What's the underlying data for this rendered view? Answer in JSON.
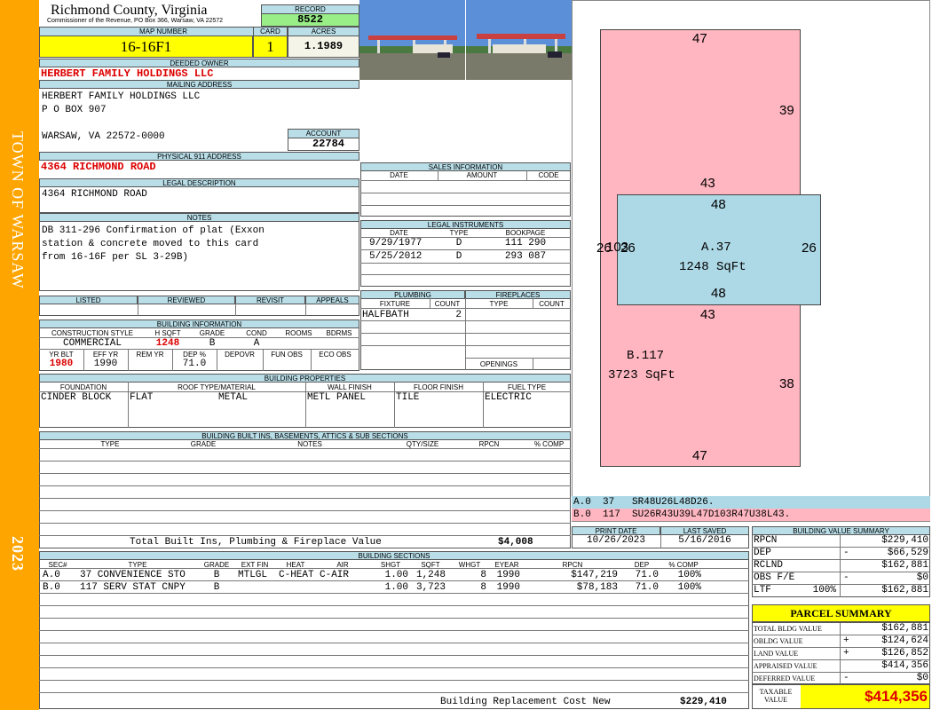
{
  "sidebar": {
    "town": "TOWN OF WARSAW",
    "year": "2023"
  },
  "header": {
    "county": "Richmond County, Virginia",
    "commissioner": "Commissioner of the Revenue, PO Box 366, Warsaw, VA 22572",
    "record_label": "RECORD",
    "record": "8522",
    "map_label": "MAP NUMBER",
    "map": "16-16F1",
    "card_label": "CARD",
    "card": "1",
    "acres_label": "ACRES",
    "acres": "1.1989"
  },
  "owner": {
    "deeded_label": "DEEDED OWNER",
    "deeded": "HERBERT FAMILY HOLDINGS LLC",
    "mailing_label": "MAILING ADDRESS",
    "mail1": "HERBERT FAMILY HOLDINGS LLC",
    "mail2": "P O BOX 907",
    "mail3": "WARSAW, VA 22572-0000",
    "account_label": "ACCOUNT",
    "account": "22784",
    "physical_label": "PHYSICAL 911 ADDRESS",
    "physical": "4364 RICHMOND ROAD",
    "legal_label": "LEGAL DESCRIPTION",
    "legal": "4364 RICHMOND ROAD",
    "notes_label": "NOTES",
    "notes": [
      "DB 311-296 Confirmation of plat (Exxon",
      "station & concrete moved to this card",
      "from 16-16F per SL 3-29B)"
    ]
  },
  "review": {
    "listed": "LISTED",
    "reviewed": "REVIEWED",
    "revisit": "REVISIT",
    "appeals": "APPEALS"
  },
  "building_info": {
    "label": "BUILDING INFORMATION",
    "h_cs": "CONSTRUCTION STYLE",
    "h_sqft": "H SQFT",
    "h_grade": "GRADE",
    "h_cond": "COND",
    "h_rooms": "ROOMS",
    "h_bdrms": "BDRMS",
    "cs": "COMMERCIAL",
    "sqft": "1248",
    "grade": "B",
    "cond": "A",
    "h_yrblt": "YR BLT",
    "h_effyr": "EFF YR",
    "h_remyr": "REM YR",
    "h_dep": "DEP %",
    "h_depovr": "DEPOVR",
    "h_funobs": "FUN OBS",
    "h_ecoobs": "ECO OBS",
    "yrblt": "1980",
    "effyr": "1990",
    "dep": "71.0"
  },
  "sales": {
    "label": "SALES INFORMATION",
    "date": "DATE",
    "amount": "AMOUNT",
    "code": "CODE"
  },
  "legal_instruments": {
    "label": "LEGAL INSTRUMENTS",
    "date": "DATE",
    "type": "TYPE",
    "bookpage": "BOOKPAGE",
    "rows": [
      {
        "date": "9/29/1977",
        "type": "D",
        "bp": "111 290"
      },
      {
        "date": "5/25/2012",
        "type": "D",
        "bp": "293 087"
      }
    ]
  },
  "plumbing": {
    "label": "PLUMBING",
    "fixture": "FIXTURE",
    "count": "COUNT",
    "row_fixture": "HALFBATH",
    "row_count": "2"
  },
  "fireplaces": {
    "label": "FIREPLACES",
    "type": "TYPE",
    "count": "COUNT",
    "openings": "OPENINGS"
  },
  "properties": {
    "label": "BUILDING PROPERTIES",
    "h_found": "FOUNDATION",
    "h_roof": "ROOF TYPE/MATERIAL",
    "h_wall": "WALL FINISH",
    "h_floor": "FLOOR FINISH",
    "h_fuel": "FUEL TYPE",
    "found": "CINDER BLOCK",
    "roof_type": "FLAT",
    "roof_mat": "METAL",
    "wall": "METL PANEL",
    "floor": "TILE",
    "fuel": "ELECTRIC"
  },
  "builtins": {
    "label": "BUILDING BUILT INS, BASEMENTS, ATTICS & SUB SECTIONS",
    "type": "TYPE",
    "grade": "GRADE",
    "notes": "NOTES",
    "qty": "QTY/SIZE",
    "rpcn": "RPCN",
    "comp": "% COMP",
    "total_label": "Total Built Ins, Plumbing & Fireplace Value",
    "total": "$4,008"
  },
  "sketch": {
    "dims": {
      "b_top": "47",
      "b_right": "39",
      "a_top_out": "43",
      "a_top": "48",
      "a_left_label": "26",
      "a_left_ov": "103",
      "a_left2": "26",
      "a_right": "26",
      "a_bot": "48",
      "a_bot_out": "43",
      "b_right2": "38",
      "b_bot": "47"
    },
    "a_label": "A.37",
    "a_area": "1248 SqFt",
    "b_label": "B.117",
    "b_area": "3723 SqFt",
    "a_code": "A.0  37   SR48U26L48D26.",
    "b_code": "B.0  117  SU26R43U39L47D103R47U38L43.",
    "color_a": "#ADD8E6",
    "color_b": "#FFB6C1"
  },
  "dates": {
    "print_label": "PRINT DATE",
    "print": "10/26/2023",
    "saved_label": "LAST SAVED",
    "saved": "5/16/2016"
  },
  "sections": {
    "label": "BUILDING SECTIONS",
    "headers": [
      "SEC#",
      "TYPE",
      "GRADE",
      "EXT FIN",
      "HEAT",
      "AIR",
      "SHGT",
      "SQFT",
      "WHGT",
      "EYEAR",
      "RPCN",
      "DEP",
      "% COMP"
    ],
    "rows": [
      [
        "A.0",
        "37 CONVENIENCE STO",
        "B",
        "MTLGL",
        "C-HEAT",
        "C-AIR",
        "1.00",
        "1,248",
        "8",
        "1990",
        "$147,219",
        "71.0",
        "100%"
      ],
      [
        "B.0",
        "117 SERV STAT CNPY",
        "B",
        "",
        "",
        "",
        "1.00",
        "3,723",
        "8",
        "1990",
        "$78,183",
        "71.0",
        "100%"
      ]
    ],
    "replacement_label": "Building Replacement Cost New",
    "replacement": "$229,410"
  },
  "value_summary": {
    "label": "BUILDING VALUE SUMMARY",
    "rows": [
      {
        "k": "RPCN",
        "s": "",
        "v": "$229,410"
      },
      {
        "k": "DEP",
        "s": "-",
        "v": "$66,529"
      },
      {
        "k": "RCLND",
        "s": "",
        "v": "$162,881"
      },
      {
        "k": "OBS F/E",
        "s": "-",
        "v": "$0"
      },
      {
        "k": "LTF",
        "p": "100%",
        "s": "",
        "v": "$162,881"
      }
    ]
  },
  "parcel": {
    "label": "PARCEL SUMMARY",
    "rows": [
      {
        "k": "TOTAL BLDG VALUE",
        "s": "",
        "v": "$162,881"
      },
      {
        "k": "OBLDG VALUE",
        "s": "+",
        "v": "$124,624"
      },
      {
        "k": "LAND VALUE",
        "s": "+",
        "v": "$126,852"
      },
      {
        "k": "APPRAISED VALUE",
        "s": "",
        "v": "$414,356"
      },
      {
        "k": "DEFERRED VALUE",
        "s": "-",
        "v": "$0"
      }
    ],
    "taxable_label1": "TAXABLE",
    "taxable_label2": "VALUE",
    "taxable": "$414,356"
  }
}
